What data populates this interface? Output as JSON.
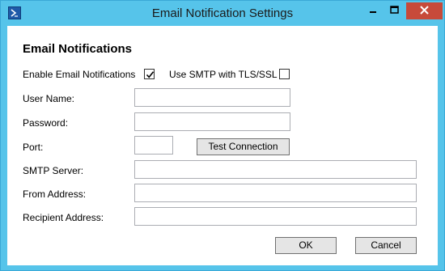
{
  "window": {
    "title": "Email Notification Settings"
  },
  "form": {
    "heading": "Email Notifications",
    "enable_label": "Enable Email Notifications",
    "enable_checked": true,
    "tls_label": "Use SMTP with TLS/SSL",
    "tls_checked": false,
    "username_label": "User Name:",
    "username_value": "",
    "password_label": "Password:",
    "password_value": "",
    "port_label": "Port:",
    "port_value": "",
    "test_button": "Test Connection",
    "smtp_label": "SMTP Server:",
    "smtp_value": "",
    "from_label": "From Address:",
    "from_value": "",
    "recipient_label": "Recipient Address:",
    "recipient_value": ""
  },
  "buttons": {
    "ok": "OK",
    "cancel": "Cancel"
  },
  "icons": {
    "app": "powershell-icon",
    "minimize": "minimize-icon",
    "maximize": "maximize-icon",
    "close": "close-icon"
  },
  "colors": {
    "titlebar": "#56c4ea",
    "close_button": "#c74a3a"
  }
}
